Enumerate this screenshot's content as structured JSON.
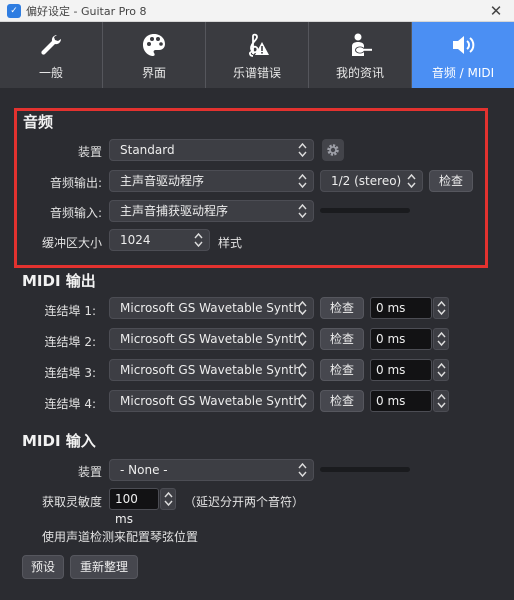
{
  "window": {
    "title": "偏好设定 - Guitar Pro 8",
    "app_icon": "shield-app-icon",
    "close": "✕"
  },
  "tabs": [
    {
      "label": "一般",
      "icon": "wrench-icon",
      "active": false
    },
    {
      "label": "界面",
      "icon": "palette-icon",
      "active": false
    },
    {
      "label": "乐谱错误",
      "icon": "clef-warning-icon",
      "active": false
    },
    {
      "label": "我的资讯",
      "icon": "guitarist-icon",
      "active": false
    },
    {
      "label": "音频 / MIDI",
      "icon": "speaker-icon",
      "active": true
    }
  ],
  "audio": {
    "title": "音频",
    "device_label": "装置",
    "device_value": "Standard",
    "output_label": "音频输出:",
    "output_value": "主声音驱动程序",
    "channels_value": "1/2 (stereo)",
    "check_label": "检查",
    "input_label": "音频输入:",
    "input_value": "主声音捕获驱动程序",
    "buffer_label": "缓冲区大小",
    "buffer_value": "1024",
    "samples_label": "样式"
  },
  "midi_out": {
    "title": "MIDI 输出",
    "ports": [
      {
        "label": "连结埠 1:",
        "device": "Microsoft GS Wavetable Synth",
        "check": "检查",
        "latency": "0 ms"
      },
      {
        "label": "连结埠 2:",
        "device": "Microsoft GS Wavetable Synth",
        "check": "检查",
        "latency": "0 ms"
      },
      {
        "label": "连结埠 3:",
        "device": "Microsoft GS Wavetable Synth",
        "check": "检查",
        "latency": "0 ms"
      },
      {
        "label": "连结埠 4:",
        "device": "Microsoft GS Wavetable Synth",
        "check": "检查",
        "latency": "0 ms"
      }
    ]
  },
  "midi_in": {
    "title": "MIDI 输入",
    "device_label": "装置",
    "device_value": "- None -",
    "sensitivity_label": "获取灵敏度",
    "sensitivity_value": "100 ms",
    "sensitivity_note": "（延迟分开两个音符）",
    "detect_label": "使用声道检测来配置琴弦位置"
  },
  "footer": {
    "preset_label": "预设",
    "reset_label": "重新整理"
  },
  "colors": {
    "accent": "#4b8ff3",
    "highlight": "#e3322f",
    "background": "#2b2c31"
  }
}
